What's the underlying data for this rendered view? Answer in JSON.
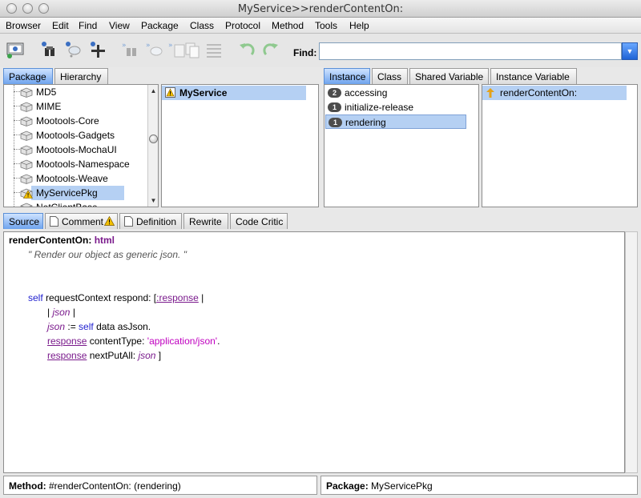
{
  "window": {
    "title": "MyService>>renderContentOn:"
  },
  "menu": [
    "Browser",
    "Edit",
    "Find",
    "View",
    "Package",
    "Class",
    "Protocol",
    "Method",
    "Tools",
    "Help"
  ],
  "toolbar": {
    "find_label": "Find:",
    "find_value": "",
    "icons": [
      "browse-icon",
      "senders-icon",
      "implementors-icon",
      "add-icon",
      "refs-icon",
      "vars-icon",
      "classvars-icon",
      "copy-icon",
      "format-icon",
      "undo-icon",
      "redo-icon"
    ]
  },
  "browser_tabs": [
    {
      "label": "Package",
      "active": true
    },
    {
      "label": "Hierarchy",
      "active": false
    }
  ],
  "packages": [
    {
      "name": "MD5",
      "selected": false,
      "warning": false
    },
    {
      "name": "MIME",
      "selected": false,
      "warning": false
    },
    {
      "name": "Mootools-Core",
      "selected": false,
      "warning": false
    },
    {
      "name": "Mootools-Gadgets",
      "selected": false,
      "warning": false
    },
    {
      "name": "Mootools-MochaUI",
      "selected": false,
      "warning": false
    },
    {
      "name": "Mootools-Namespace",
      "selected": false,
      "warning": false
    },
    {
      "name": "Mootools-Weave",
      "selected": false,
      "warning": false
    },
    {
      "name": "MyServicePkg",
      "selected": true,
      "warning": true
    },
    {
      "name": "NetClientBase",
      "selected": false,
      "warning": false
    }
  ],
  "classes": [
    {
      "name": "MyService",
      "selected": true
    }
  ],
  "scope_tabs": [
    {
      "label": "Instance",
      "active": true
    },
    {
      "label": "Class",
      "active": false
    },
    {
      "label": "Shared Variable",
      "active": false
    },
    {
      "label": "Instance Variable",
      "active": false
    }
  ],
  "protocols": [
    {
      "count": "2",
      "name": "accessing",
      "selected": false
    },
    {
      "count": "1",
      "name": "initialize-release",
      "selected": false
    },
    {
      "count": "1",
      "name": "rendering",
      "selected": true
    }
  ],
  "methods": [
    {
      "name": "renderContentOn:",
      "selected": true
    }
  ],
  "editor_tabs": [
    {
      "label": "Source",
      "active": true
    },
    {
      "label": "Comment",
      "active": false
    },
    {
      "label": "Definition",
      "active": false
    },
    {
      "label": "Rewrite",
      "active": false
    },
    {
      "label": "Code Critic",
      "active": false
    }
  ],
  "code": {
    "selector": "renderContentOn:",
    "arg": "html",
    "comment": "\" Render our object as generic json. \"",
    "l1_self": "self",
    "l1_rest": "requestContext respond: [",
    "l1_arg": ":response",
    "l1_bar": "|",
    "l2_open": "|",
    "l2_var": "json",
    "l2_close": "|",
    "l3_var": "json",
    "l3_assign": ":=",
    "l3_self": "self",
    "l3_rest": "data asJson.",
    "l4_arg": "response",
    "l4_rest": "contentType:",
    "l4_str": "'application/json'",
    "l4_end": ".",
    "l5_arg": "response",
    "l5_rest": "nextPutAll:",
    "l5_var": "json",
    "l5_end": "]"
  },
  "status": {
    "method_label": "Method:",
    "method_value": "#renderContentOn: (rendering)",
    "package_label": "Package:",
    "package_value": "MyServicePkg"
  }
}
